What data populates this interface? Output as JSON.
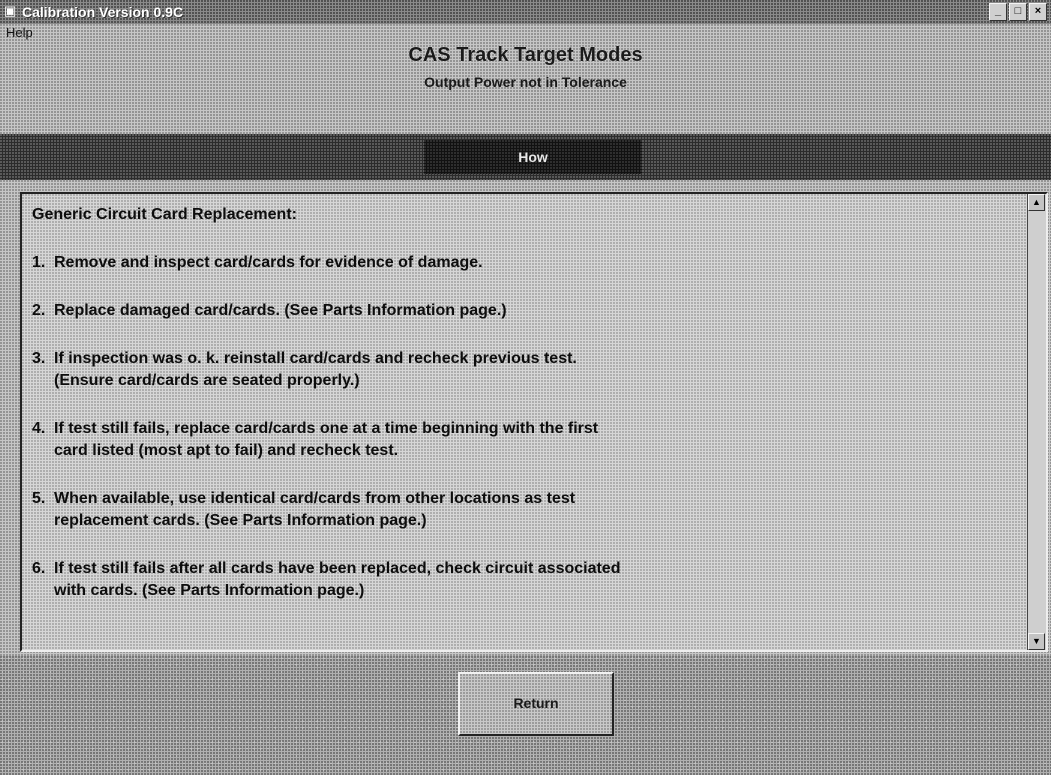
{
  "window": {
    "title": "Calibration Version 0.9C",
    "controls": [
      "_",
      "□",
      "×"
    ]
  },
  "menu": {
    "items": [
      "Help"
    ]
  },
  "header": {
    "title": "CAS Track Target Modes",
    "subtitle": "Output Power not in Tolerance"
  },
  "band": {
    "button_label": "How"
  },
  "content": {
    "heading": "Generic Circuit Card Replacement:",
    "steps": [
      {
        "num": "1.",
        "text": "Remove and inspect card/cards for evidence of damage."
      },
      {
        "num": "2.",
        "text": "Replace damaged card/cards.  (See Parts Information page.)"
      },
      {
        "num": "3.",
        "text": "If inspection was o. k. reinstall card/cards and recheck previous test.\n(Ensure card/cards are seated properly.)"
      },
      {
        "num": "4.",
        "text": "If test still fails, replace card/cards one at a time beginning with the first\ncard listed (most apt to fail) and recheck test."
      },
      {
        "num": "5.",
        "text": "When available, use identical card/cards from other locations as test\nreplacement cards.  (See Parts Information page.)"
      },
      {
        "num": "6.",
        "text": "If test still fails after all cards have been replaced, check circuit associated\nwith cards.  (See Parts Information page.)"
      }
    ]
  },
  "footer": {
    "return_label": "Return"
  },
  "icons": {
    "app": "app-icon",
    "scroll_up": "scroll-up-arrow-icon",
    "scroll_down": "scroll-down-arrow-icon"
  }
}
